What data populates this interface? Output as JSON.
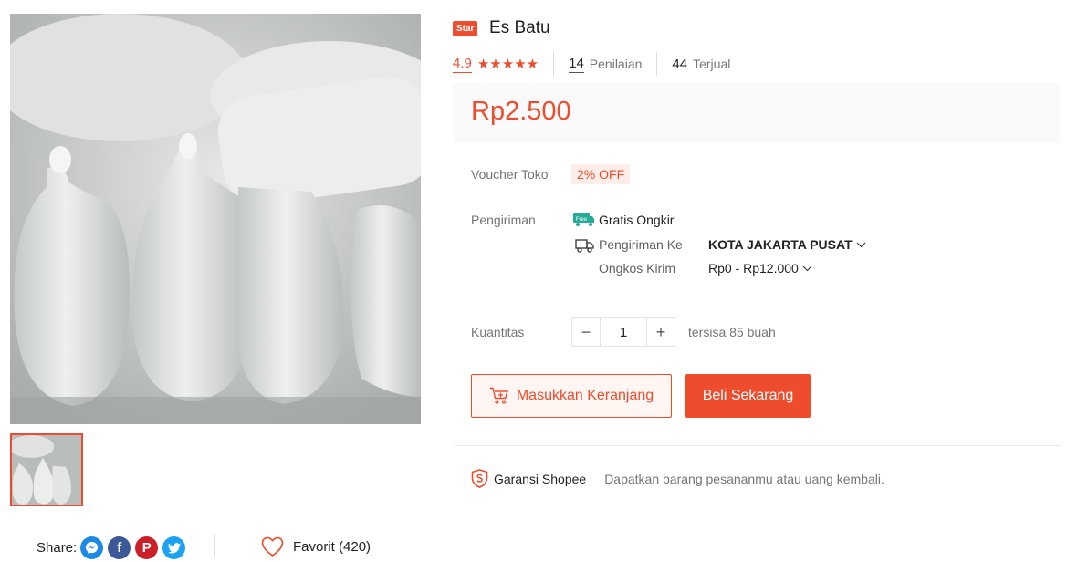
{
  "product": {
    "badge": "Star",
    "title": "Es Batu",
    "rating": "4.9",
    "stars": "★★★★★",
    "reviews_count": "14",
    "reviews_label": "Penilaian",
    "sold_count": "44",
    "sold_label": "Terjual",
    "price": "Rp2.500"
  },
  "voucher": {
    "label": "Voucher Toko",
    "value": "2% OFF"
  },
  "shipping": {
    "label": "Pengiriman",
    "free_icon_text": "Free",
    "free_text": "Gratis Ongkir",
    "to_label": "Pengiriman Ke",
    "to_value": "KOTA JAKARTA PUSAT",
    "cost_label": "Ongkos Kirim",
    "cost_value": "Rp0 - Rp12.000"
  },
  "quantity": {
    "label": "Kuantitas",
    "minus": "−",
    "value": "1",
    "plus": "+",
    "stock": "tersisa 85 buah"
  },
  "actions": {
    "add_to_cart": "Masukkan Keranjang",
    "buy_now": "Beli Sekarang"
  },
  "guarantee": {
    "title": "Garansi Shopee",
    "text": "Dapatkan barang pesananmu atau uang kembali."
  },
  "share": {
    "label": "Share:",
    "icons": [
      "messenger-icon",
      "facebook-icon",
      "pinterest-icon",
      "twitter-icon"
    ]
  },
  "favorite": {
    "label": "Favorit (420)"
  },
  "colors": {
    "accent": "#ee4d2d",
    "messenger": "#1e88e5",
    "facebook": "#3b5999",
    "pinterest": "#cb2027",
    "twitter": "#1da1f2"
  }
}
